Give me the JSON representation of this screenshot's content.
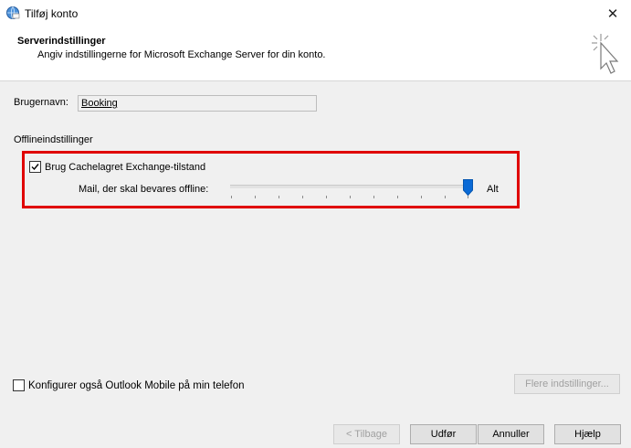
{
  "window": {
    "title": "Tilføj konto",
    "close_glyph": "✕",
    "icon": "globe-mail-icon"
  },
  "header": {
    "title": "Serverindstillinger",
    "subtitle": "Angiv indstillingerne for Microsoft Exchange Server for din konto.",
    "art_icon": "cursor-sparkle-icon"
  },
  "form": {
    "username_label": "Brugernavn:",
    "username_value": "Booking",
    "offline_section_label": "Offlineindstillinger",
    "cached_mode_label": "Brug Cachelagret Exchange-tilstand",
    "cached_mode_checked": true,
    "slider_label": "Mail, der skal bevares offline:",
    "slider_value_label": "Alt",
    "slider_position": 1.0,
    "mobile_label": "Konfigurer også Outlook Mobile på min telefon",
    "mobile_checked": false,
    "more_settings_label": "Flere indstillinger..."
  },
  "footer": {
    "back_label": "< Tilbage",
    "finish_label": "Udfør",
    "cancel_label": "Annuller",
    "help_label": "Hjælp"
  },
  "colors": {
    "highlight": "#e00000",
    "slider_thumb": "#0a6ad6"
  }
}
